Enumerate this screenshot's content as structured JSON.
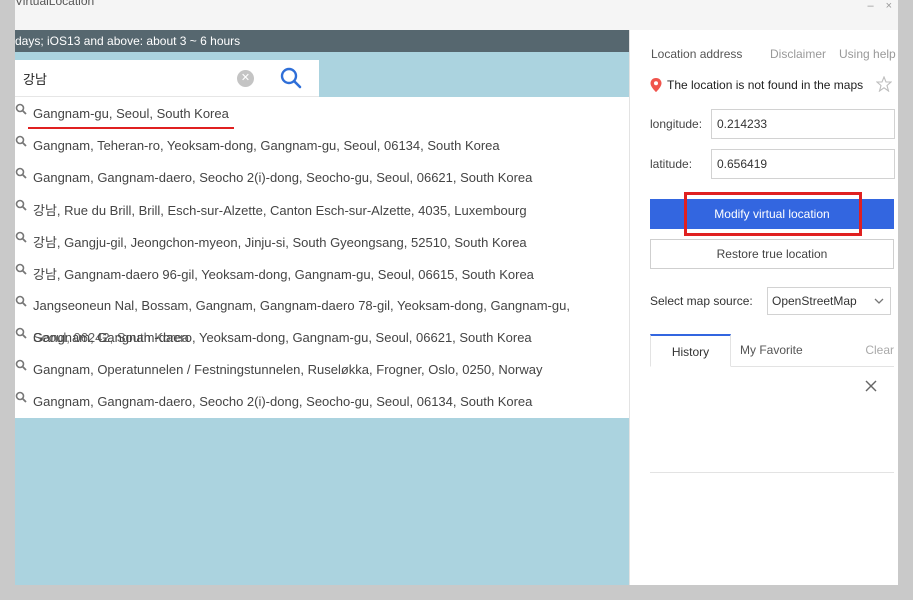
{
  "window": {
    "title": "VirtualLocation",
    "notice": "days; iOS13 and above: about 3 ~ 6 hours"
  },
  "search": {
    "value": "강남",
    "clear_icon": "clear-circle-icon",
    "search_icon": "magnifier-icon"
  },
  "results": [
    {
      "text": "Gangnam-gu, Seoul, South Korea",
      "highlighted": true
    },
    {
      "text": "Gangnam, Teheran-ro, Yeoksam-dong, Gangnam-gu, Seoul, 06134, South Korea"
    },
    {
      "text": "Gangnam, Gangnam-daero, Seocho 2(i)-dong, Seocho-gu, Seoul, 06621, South Korea"
    },
    {
      "text": "강남, Rue du Brill, Brill, Esch-sur-Alzette, Canton Esch-sur-Alzette, 4035, Luxembourg"
    },
    {
      "text": "강남, Gangju-gil, Jeongchon-myeon, Jinju-si, South Gyeongsang, 52510, South Korea"
    },
    {
      "text": "강남, Gangnam-daero 96-gil, Yeoksam-dong, Gangnam-gu, Seoul, 06615, South Korea"
    },
    {
      "text": "Jangseoneun Nal, Bossam, Gangnam, Gangnam-daero 78-gil, Yeoksam-dong, Gangnam-gu,"
    },
    {
      "text": "Seoul, 06242, South Korea",
      "overlap": "Gangnam, Gangnam-daero, Yeoksam-dong, Gangnam-gu, Seoul, 06621, South Korea"
    },
    {
      "text": "Gangnam, Operatunnelen / Festningstunnelen, Ruseløkka, Frogner, Oslo, 0250, Norway"
    },
    {
      "text": "Gangnam, Gangnam-daero, Seocho 2(i)-dong, Seocho-gu, Seoul, 06134, South Korea"
    }
  ],
  "panel": {
    "location_address_label": "Location address",
    "disclaimer_label": "Disclaimer",
    "help_label": "Using help",
    "status_text": "The location is not found in the maps",
    "longitude_label": "longitude:",
    "longitude_value": "0.214233",
    "latitude_label": "latitude:",
    "latitude_value": "0.656419",
    "modify_button": "Modify virtual location",
    "restore_button": "Restore true location",
    "map_source_label": "Select map source:",
    "map_source_value": "OpenStreetMap",
    "tab_history": "History",
    "tab_favorite": "My Favorite",
    "clear_label": "Clear"
  },
  "colors": {
    "accent": "#3366e0",
    "annotation_red": "#e02020",
    "map_water": "#abd3df",
    "notice_bar": "#56676f"
  }
}
